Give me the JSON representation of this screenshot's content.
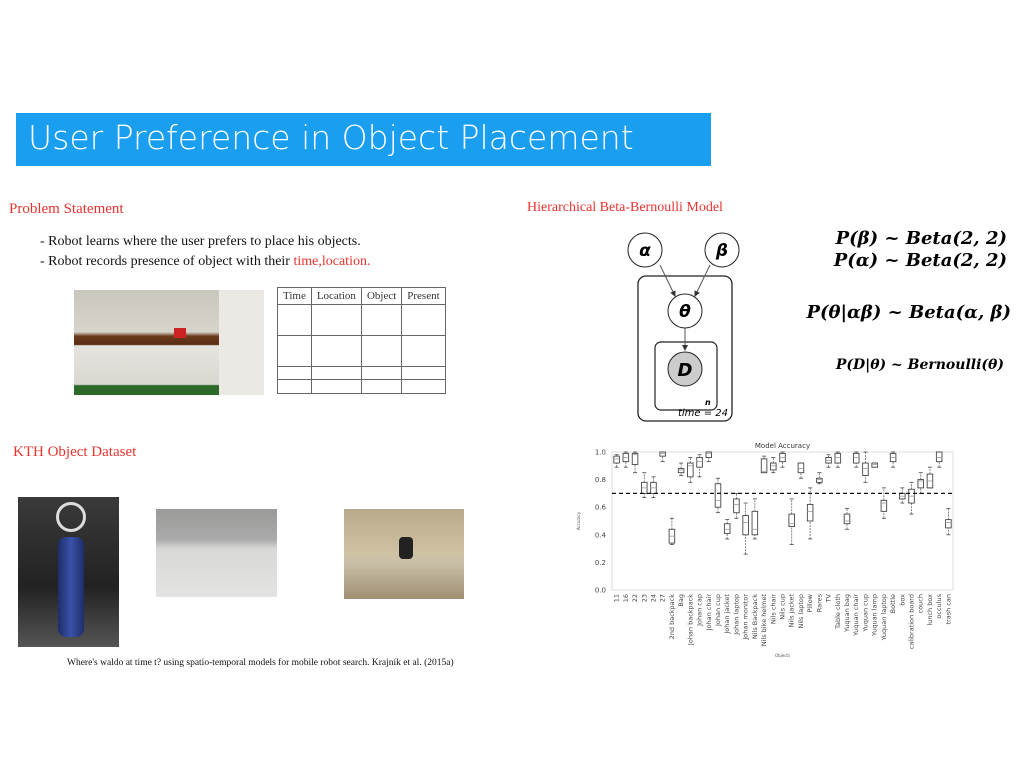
{
  "slide": {
    "title": "User Preference in Object Placement"
  },
  "problem": {
    "heading": "Problem Statement",
    "bullet1": "- Robot learns where the user prefers to place his objects.",
    "bullet2_prefix": "- Robot records presence of object with their ",
    "bullet2_highlight": "time,location.",
    "table_headers": [
      "Time",
      "Location",
      "Object",
      "Present"
    ]
  },
  "model": {
    "heading": "Hierarchical Beta-Bernoulli Model",
    "nodes": {
      "alpha": "α",
      "beta": "β",
      "theta": "θ",
      "d": "D"
    },
    "inner_plate_label": "n",
    "outer_plate_label": "time = 24",
    "eq1": "P(β) ~ Beta(2, 2)",
    "eq2": "P(α) ~ Beta(2, 2)",
    "eq3": "P(θ|αβ) ~ Beta(α, β)",
    "eq4": "P(D|θ) ~ Bernoulli(θ)"
  },
  "dataset": {
    "heading": "KTH Object Dataset",
    "citation": "Where's waldo at time t? using spatio-temporal models for mobile robot search. Krajník et al. (2015a)"
  },
  "colors": {
    "title_bar": "#1a9ff0",
    "heading_red": "#e8332f",
    "highlight_red": "#e8332f"
  },
  "chart_data": {
    "type": "box",
    "title": "Model Accuracy",
    "xlabel": "Objects",
    "ylabel": "Accuracy",
    "ylim": [
      0,
      1
    ],
    "yticks": [
      "0.0",
      "0.2",
      "0.4",
      "0.6",
      "0.8",
      "1.0"
    ],
    "reference_line": 0.7,
    "grid": false,
    "categories": [
      "11",
      "16",
      "22",
      "23",
      "24",
      "27",
      "2nd backpack",
      "Bag",
      "Johan backpack",
      "Johan cap",
      "Johan chair",
      "Johan cup",
      "Johan jacket",
      "Johan laptop",
      "Johan monitor",
      "Nils Backpack",
      "Nils bike helmet",
      "Nils chair",
      "Nils cup",
      "Nils jacket",
      "Nils laptop",
      "Pillow",
      "Rares",
      "TV",
      "Table cloth",
      "Yuquan bag",
      "Yuquan chair",
      "Yuquan cup",
      "Yuquan lamp",
      "Yuquan laptop",
      "Bottle",
      "box",
      "calibration board",
      "couch",
      "lunch box",
      "occulus",
      "trash can"
    ],
    "boxes": [
      [
        0.89,
        0.92,
        0.95,
        0.97,
        0.98
      ],
      [
        0.89,
        0.93,
        0.96,
        0.99,
        1.0
      ],
      [
        0.85,
        0.91,
        0.98,
        0.99,
        1.0
      ],
      [
        0.67,
        0.7,
        0.74,
        0.78,
        0.85
      ],
      [
        0.67,
        0.7,
        0.74,
        0.78,
        0.82
      ],
      [
        0.93,
        0.97,
        0.99,
        1.0,
        1.0
      ],
      [
        0.33,
        0.34,
        0.39,
        0.44,
        0.52
      ],
      [
        0.83,
        0.85,
        0.87,
        0.88,
        0.92
      ],
      [
        0.78,
        0.82,
        0.9,
        0.92,
        0.96
      ],
      [
        0.82,
        0.89,
        0.93,
        0.96,
        0.98
      ],
      [
        0.93,
        0.96,
        0.99,
        1.0,
        1.0
      ],
      [
        0.56,
        0.6,
        0.65,
        0.77,
        0.81
      ],
      [
        0.37,
        0.41,
        0.44,
        0.48,
        0.51
      ],
      [
        0.52,
        0.56,
        0.62,
        0.66,
        0.7
      ],
      [
        0.26,
        0.4,
        0.49,
        0.54,
        0.63
      ],
      [
        0.37,
        0.4,
        0.44,
        0.57,
        0.66
      ],
      [
        0.85,
        0.85,
        0.86,
        0.95,
        0.97
      ],
      [
        0.85,
        0.87,
        0.9,
        0.92,
        0.96
      ],
      [
        0.89,
        0.93,
        0.96,
        0.99,
        1.0
      ],
      [
        0.33,
        0.46,
        0.48,
        0.55,
        0.66
      ],
      [
        0.81,
        0.85,
        0.88,
        0.92,
        0.92
      ],
      [
        0.37,
        0.5,
        0.57,
        0.62,
        0.74
      ],
      [
        0.77,
        0.78,
        0.8,
        0.81,
        0.85
      ],
      [
        0.89,
        0.92,
        0.94,
        0.96,
        0.98
      ],
      [
        0.89,
        0.92,
        0.96,
        0.99,
        1.0
      ],
      [
        0.44,
        0.48,
        0.5,
        0.55,
        0.59
      ],
      [
        0.89,
        0.92,
        0.96,
        0.99,
        1.0
      ],
      [
        0.78,
        0.83,
        0.88,
        0.92,
        1.0
      ],
      [
        0.89,
        0.89,
        0.91,
        0.92,
        0.92
      ],
      [
        0.52,
        0.57,
        0.63,
        0.65,
        0.74
      ],
      [
        0.89,
        0.93,
        0.96,
        0.99,
        1.0
      ],
      [
        0.63,
        0.66,
        0.68,
        0.7,
        0.74
      ],
      [
        0.55,
        0.63,
        0.68,
        0.73,
        0.78
      ],
      [
        0.7,
        0.74,
        0.79,
        0.8,
        0.85
      ],
      [
        0.74,
        0.74,
        0.79,
        0.84,
        0.89
      ],
      [
        0.89,
        0.93,
        0.96,
        1.0,
        1.0
      ],
      [
        0.4,
        0.45,
        0.49,
        0.51,
        0.59
      ]
    ],
    "box_format": "[whisker_low, q1, median, q3, whisker_high]"
  }
}
